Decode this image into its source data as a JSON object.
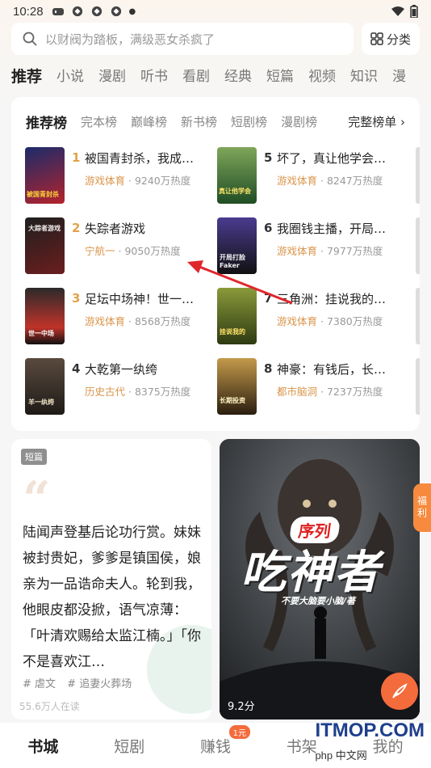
{
  "status_bar": {
    "time": "10:28"
  },
  "search": {
    "placeholder": "以财阀为踏板，满级恶女杀疯了",
    "category_label": "分类"
  },
  "channels": [
    "推荐",
    "小说",
    "漫剧",
    "听书",
    "看剧",
    "经典",
    "短篇",
    "视频",
    "知识",
    "漫"
  ],
  "rank": {
    "tabs": [
      "推荐榜",
      "完本榜",
      "巅峰榜",
      "新书榜",
      "短剧榜",
      "漫剧榜"
    ],
    "more_label": "完整榜单 ›",
    "books": [
      {
        "rank": "1",
        "title": "被国青封杀，我成…",
        "genre": "游戏体育",
        "heat": "· 9240万热度",
        "cover_color": "#b3232c"
      },
      {
        "rank": "2",
        "title": "失踪者游戏",
        "genre": "宁航一",
        "heat": "· 9050万热度",
        "cover_color": "#3c3a38"
      },
      {
        "rank": "3",
        "title": "足坛中场神！世一…",
        "genre": "游戏体育",
        "heat": "· 8568万热度",
        "cover_color": "#6d3b2c"
      },
      {
        "rank": "4",
        "title": "大乾第一纨绔",
        "genre": "历史古代",
        "heat": "· 8375万热度",
        "cover_color": "#4a3d35"
      },
      {
        "rank": "5",
        "title": "坏了，真让他学会…",
        "genre": "游戏体育",
        "heat": "· 8247万热度",
        "cover_color": "#2d6b2f"
      },
      {
        "rank": "6",
        "title": "我圈钱主播，开局…",
        "genre": "游戏体育",
        "heat": "· 7977万热度",
        "cover_color": "#3c3a74"
      },
      {
        "rank": "7",
        "title": "三角洲：挂说我的…",
        "genre": "游戏体育",
        "heat": "· 7380万热度",
        "cover_color": "#5b6b2a"
      },
      {
        "rank": "8",
        "title": "神豪：有钱后，长…",
        "genre": "都市脑洞",
        "heat": "· 7237万热度",
        "cover_color": "#7a5a2a"
      }
    ],
    "cover_texts": [
      "被国青封杀",
      "大踪者游戏",
      "世一中场",
      "羊一纨绔",
      "真让他学会",
      "开局打脸 Faker",
      "挂说我的",
      "长期投资"
    ]
  },
  "quote_card": {
    "badge": "短篇",
    "text": "陆闻声登基后论功行赏。妹妹被封贵妃，爹爹是镇国侯，娘亲为一品诰命夫人。轮到我，他眼皮都没掀，语气凉薄：「叶清欢赐给太监江楠。」「你不是喜欢江…",
    "tags": [
      "# 虐文",
      "# 追妻火葬场"
    ],
    "readers": "55.6万人在读"
  },
  "poster_card": {
    "series_label": "序列",
    "title": "吃神者",
    "author_line": "不要大脑要小脑/著",
    "score": "9.2分"
  },
  "welfare_label": "福利",
  "bottom_nav": {
    "items": [
      "书城",
      "短剧",
      "赚钱",
      "书架",
      "我的"
    ],
    "earn_badge": "1元"
  },
  "watermark": {
    "main": "ITMOP.COM",
    "sub": "php 中文网"
  },
  "colors": {
    "accent": "#f46b3c",
    "gold": "#e2a24a",
    "genre": "#d9954a",
    "annotation_arrow": "#e0262b"
  }
}
